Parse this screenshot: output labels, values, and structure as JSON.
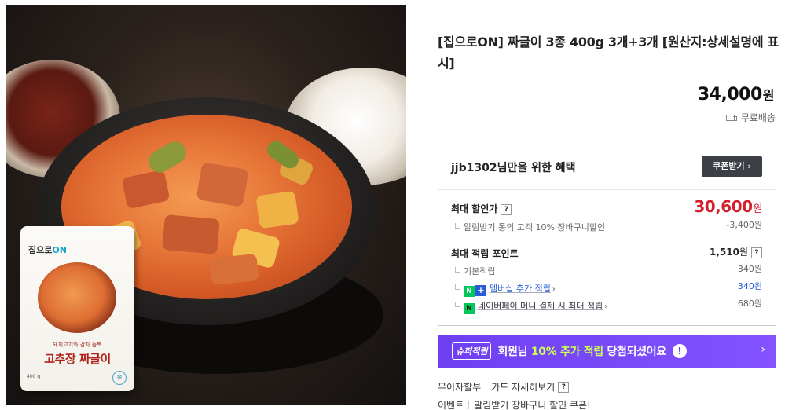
{
  "product": {
    "title": "[집으로ON] 짜글이 3종 400g 3개+3개 [원산지:상세설명에 표시]",
    "price": "34,000",
    "price_unit": "원",
    "shipping": "무료배송",
    "image": {
      "pack_brand_prefix": "집으로",
      "pack_brand_suffix": "ON",
      "pack_subtitle": "돼지고기와 감자 듬뿍",
      "pack_title": "고추장 짜글이",
      "pack_weight": "400 g"
    }
  },
  "benefit": {
    "heading": "jjb1302님만을 위한 혜택",
    "coupon_button": "쿠폰받기 ›",
    "max_discount_label": "최대 할인가",
    "max_discount_value": "30,600",
    "max_discount_unit": "원",
    "discount_sub_label": "알림받기 동의 고객 10% 장바구니할인",
    "discount_sub_value": "-3,400원",
    "max_point_label": "최대 적립 포인트",
    "max_point_value": "1,510",
    "max_point_unit": "원",
    "points": [
      {
        "label": "기본적립",
        "value": "340원"
      },
      {
        "label": "멤버십 추가 적립",
        "value": "340원"
      },
      {
        "label": "네이버페이 머니 결제 시 최대 적립",
        "value": "680원"
      }
    ]
  },
  "banner": {
    "tag": "슈퍼적립",
    "text_prefix": "회원님 ",
    "text_highlight": "10% 추가 적립",
    "text_suffix": " 당첨되셨어요"
  },
  "footer": {
    "installment": "무이자할부",
    "card_detail": "카드 자세히보기",
    "event_label": "이벤트",
    "event_text": "알림받기 장바구니 할인 쿠폰!"
  },
  "colors": {
    "discount_red": "#d41f2d",
    "naver_green": "#03c75a",
    "banner_purple": "#7c4dff"
  }
}
